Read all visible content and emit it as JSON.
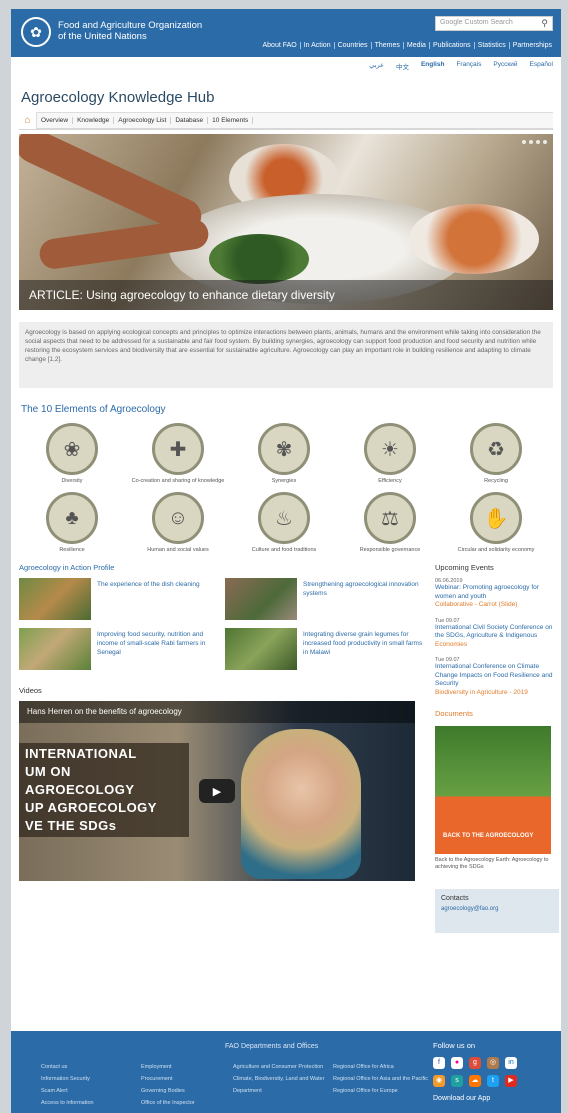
{
  "header": {
    "org_line1": "Food and Agriculture Organization",
    "org_line2": "of the United Nations",
    "search_placeholder": "Google Custom Search",
    "topnav": [
      "About FAO",
      "In Action",
      "Countries",
      "Themes",
      "Media",
      "Publications",
      "Statistics",
      "Partnerships"
    ]
  },
  "langs": [
    "عربي",
    "中文",
    "English",
    "Français",
    "Русский",
    "Español"
  ],
  "hub_title": "Agroecology Knowledge Hub",
  "subnav": [
    "Overview",
    "Knowledge",
    "Agroecology List",
    "Database",
    "10 Elements"
  ],
  "hero": {
    "caption": "ARTICLE: Using agroecology to enhance dietary diversity"
  },
  "intro": "Agroecology is based on applying ecological concepts and principles to optimize interactions between plants, animals, humans and the environment while taking into consideration the social aspects that need to be addressed for a sustainable and fair food system. By building synergies, agroecology can support food production and food security and nutrition while restoring the ecosystem services and biodiversity that are essential for sustainable agriculture. Agroecology can play an important role in building resilience and adapting to climate change [1,2].",
  "elements_title": "The 10 Elements of Agroecology",
  "elements": [
    "Diversity",
    "Co-creation and sharing of knowledge",
    "Synergies",
    "Efficiency",
    "Recycling",
    "Resilience",
    "Human and social values",
    "Culture and food traditions",
    "Responsible governance",
    "Circular and solidarity economy"
  ],
  "action_title": "Agroecology in Action Profile",
  "stories": [
    "The experience of the dish cleaning",
    "Strengthening agroecological innovation systems",
    "Improving food security, nutrition and income of small-scale Rabi farmers in Senegal",
    "Integrating diverse grain legumes for increased food productivity in small farms in Malawi"
  ],
  "videos_title": "Videos",
  "video": {
    "title": "Hans Herren on the benefits of agroecology",
    "banner": [
      "INTERNATIONAL",
      "UM ON AGROECOLOGY",
      "UP AGROECOLOGY",
      "VE THE SDGs"
    ]
  },
  "events_title": "Upcoming Events",
  "events": [
    {
      "date": "06.06.2019",
      "title": "Webinar: Promoting agroecology for women and youth",
      "extra": "Collaborative - Carrot (Slide)"
    },
    {
      "date": "Tue 09.07",
      "title": "International Civil Society Conference on the SDGs, Agriculture & Indigenous",
      "extra": "Economies"
    },
    {
      "date": "Tue 09.07",
      "title": "International Conference on Climate Change Impacts on Food Resilience and Security",
      "extra": "Biodiversity in Agriculture - 2019"
    }
  ],
  "docs_title": "Documents",
  "doc": {
    "cover_title": "BACK TO THE AGROECOLOGY",
    "caption": "Back to the Agroecology Earth: Agroecology to achieving the SDGs"
  },
  "contacts_title": "Contacts",
  "contacts_link": "agroecology@fao.org",
  "footer": {
    "heading": "FAO Departments and Offices",
    "col1": [
      "Contact us",
      "Information Security",
      "Scam Alert",
      "Access to information"
    ],
    "col2": [
      "Employment",
      "Procurement",
      "Governing Bodies",
      "Office of the Inspector"
    ],
    "col3": [
      "Agriculture and Consumer Protection",
      "Climate, Biodiversity, Land and Water Department"
    ],
    "col4": [
      "Regional Office for Africa",
      "Regional Office for Asia and the Pacific",
      "Regional Office for Europe"
    ],
    "follow": "Follow us on",
    "download": "Download our App"
  },
  "colors": {
    "brand_blue": "#2b6ba8",
    "accent_orange": "#e07c2c"
  }
}
